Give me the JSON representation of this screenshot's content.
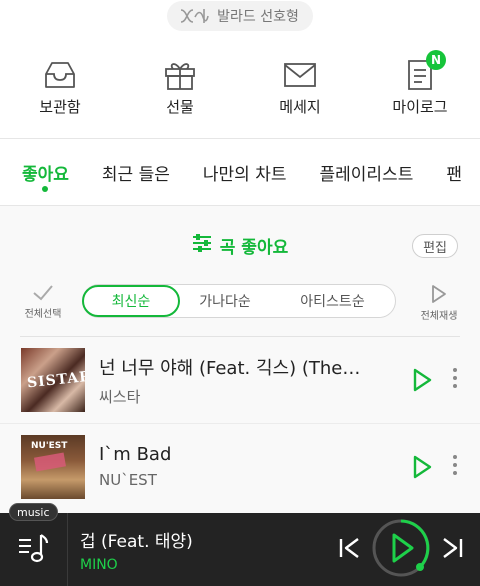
{
  "top": {
    "preference_label": "발라드 선호형"
  },
  "quick_menu": [
    {
      "label": "보관함",
      "icon": "inbox-icon"
    },
    {
      "label": "선물",
      "icon": "gift-icon"
    },
    {
      "label": "메세지",
      "icon": "mail-icon"
    },
    {
      "label": "마이로그",
      "icon": "document-icon",
      "badge": "N"
    }
  ],
  "tabs": [
    {
      "label": "좋아요",
      "active": true
    },
    {
      "label": "최근 들은"
    },
    {
      "label": "나만의 차트"
    },
    {
      "label": "플레이리스트"
    },
    {
      "label": "팬"
    }
  ],
  "likes": {
    "title": "곡 좋아요",
    "edit_label": "편집"
  },
  "sort": {
    "select_all": "전체선택",
    "play_all": "전체재생",
    "options": [
      "최신순",
      "가나다순",
      "아티스트순"
    ],
    "selected": "최신순"
  },
  "songs": [
    {
      "title": "넌 너무 야해 (Feat. 긱스) (The…",
      "artist": "씨스타",
      "thumb_text": "SISTAR"
    },
    {
      "title": "I`m Bad",
      "artist": "NU`EST",
      "thumb_text": "NU'EST"
    }
  ],
  "player": {
    "tag": "music",
    "title": "겁 (Feat. 태양)",
    "artist": "MINO"
  },
  "colors": {
    "accent": "#14b83a",
    "player_bg": "#232323"
  }
}
